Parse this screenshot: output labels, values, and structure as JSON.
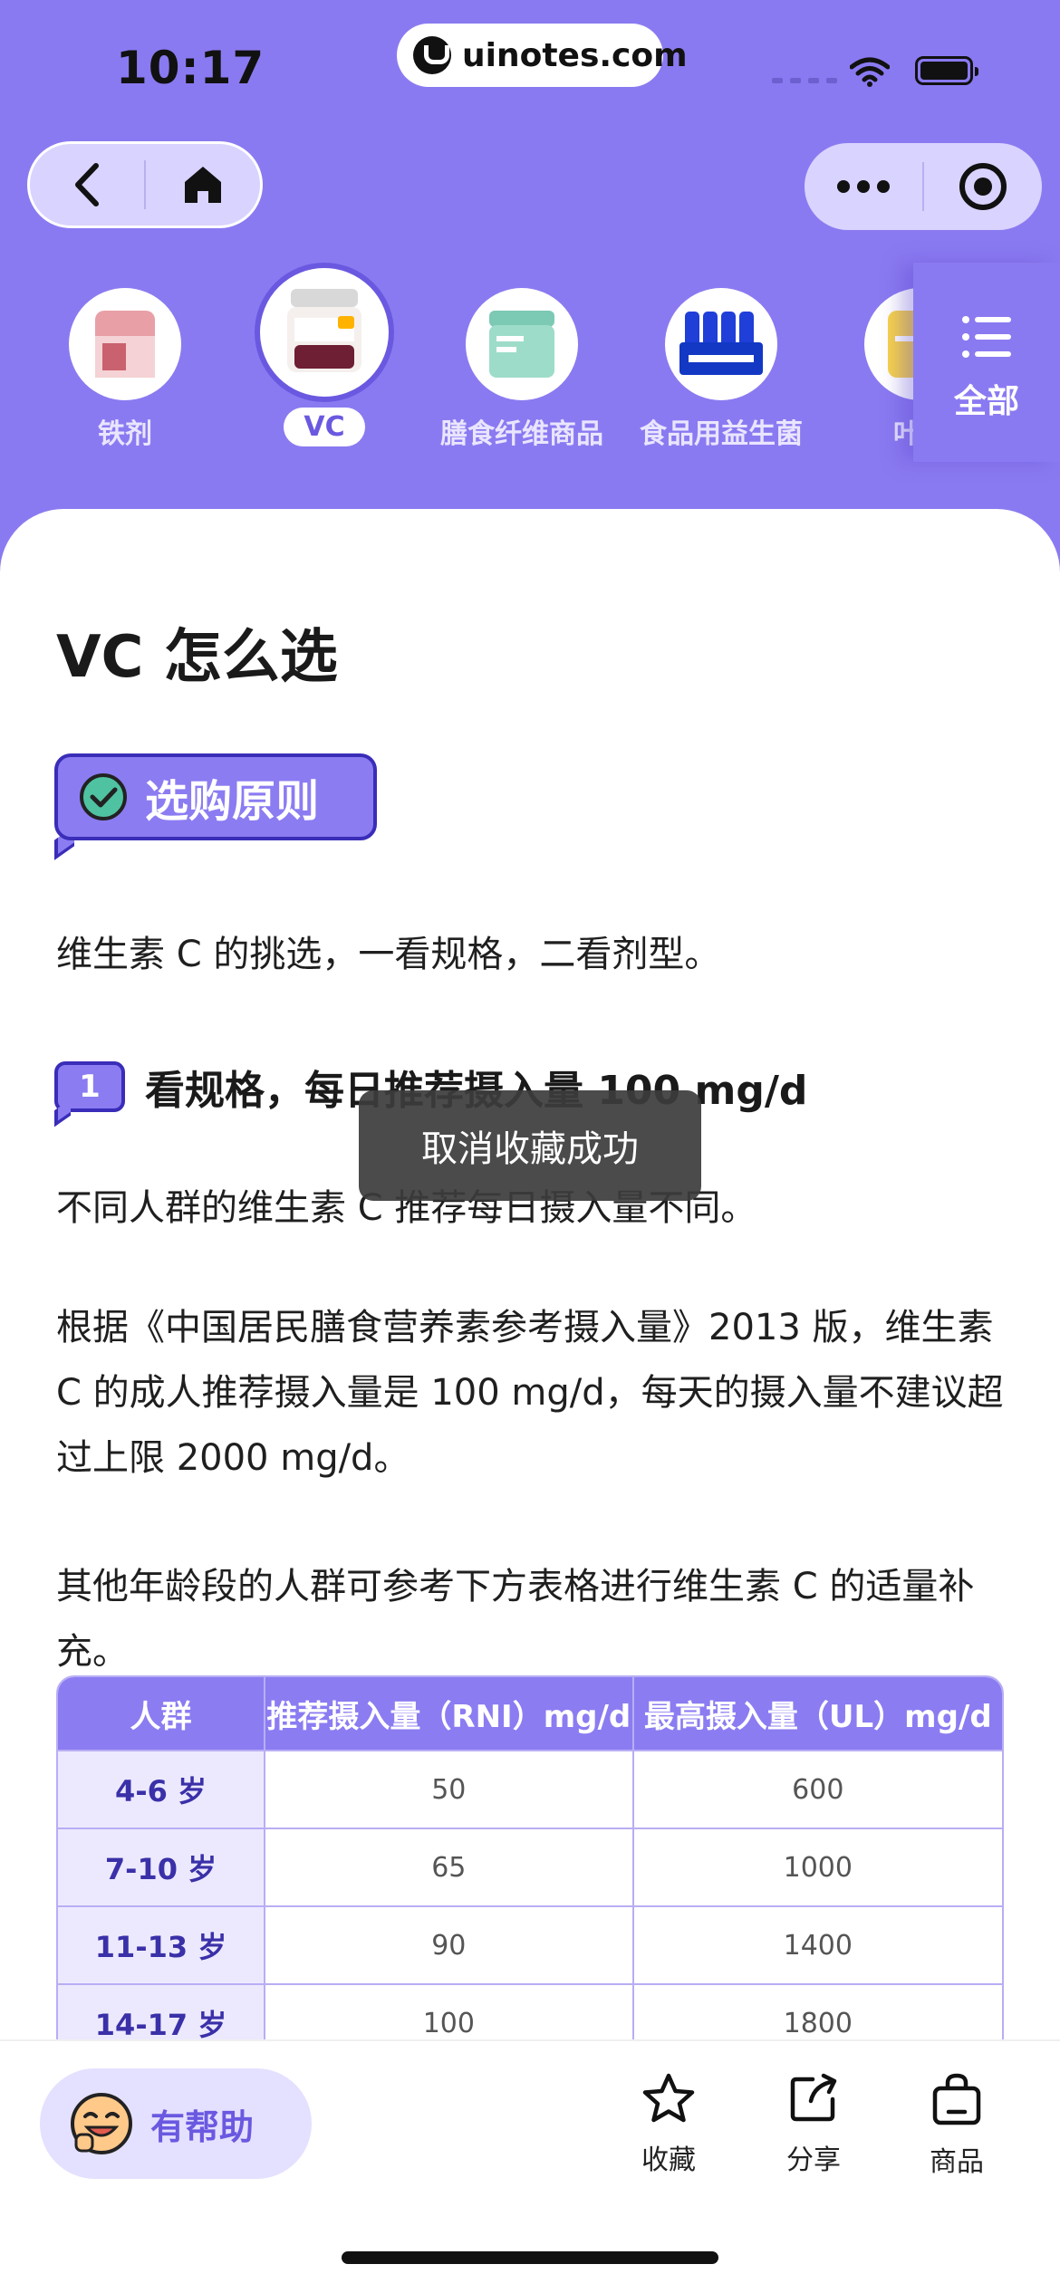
{
  "status_bar": {
    "time": "10:17",
    "url": "uinotes.com"
  },
  "categories": [
    {
      "label": "铁剂",
      "active": false
    },
    {
      "label": "VC",
      "active": true
    },
    {
      "label": "膳食纤维商品",
      "active": false
    },
    {
      "label": "食品用益生菌",
      "active": false
    },
    {
      "label": "叶酸",
      "active": false
    }
  ],
  "all_button": {
    "label": "全部",
    "icon": "list-icon"
  },
  "article": {
    "title": "VC 怎么选",
    "section_badge": "选购原则",
    "intro": "维生素 C 的挑选，一看规格，二看剂型。",
    "h2_number": "1",
    "h2_text": "看规格，每日推荐摄入量 100 mg/d",
    "p1": "不同人群的维生素 C 推荐每日摄入量不同。",
    "p2": "根据《中国居民膳食营养素参考摄入量》2013 版，维生素 C 的成人推荐摄入量是 100 mg/d，每天的摄入量不建议超过上限 2000 mg/d。",
    "p3": "其他年龄段的人群可参考下方表格进行维生素 C 的适量补充。"
  },
  "table": {
    "headers": [
      "人群",
      "推荐摄入量（RNI）mg/d",
      "最高摄入量（UL）mg/d"
    ],
    "rows": [
      [
        "4-6 岁",
        "50",
        "600"
      ],
      [
        "7-10 岁",
        "65",
        "1000"
      ],
      [
        "11-13 岁",
        "90",
        "1400"
      ],
      [
        "14-17 岁",
        "100",
        "1800"
      ]
    ]
  },
  "toast": "取消收藏成功",
  "bottom_bar": {
    "helpful": "有帮助",
    "favorite": "收藏",
    "share": "分享",
    "product": "商品"
  },
  "colors": {
    "accent": "#8a7af1",
    "accent_dark": "#3a2db8"
  }
}
